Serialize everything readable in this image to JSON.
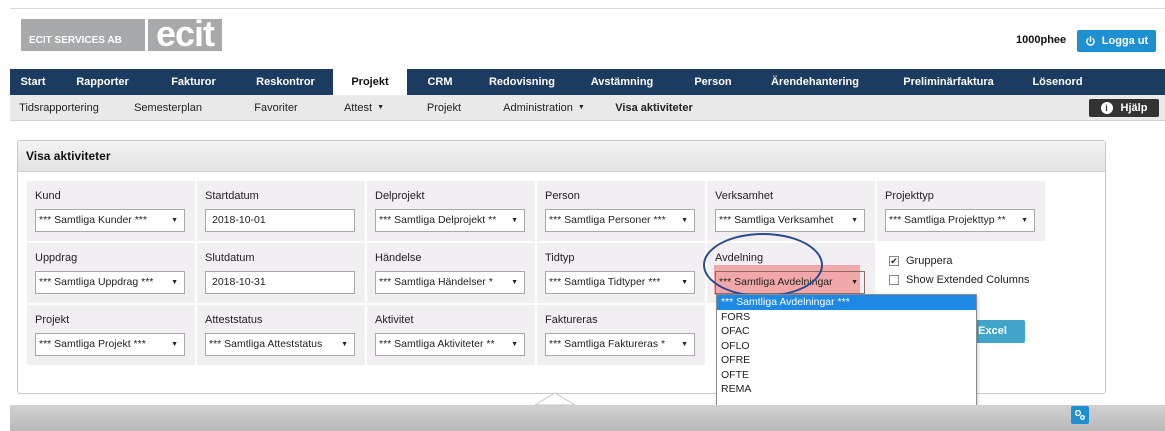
{
  "header": {
    "logo_left": "ECIT SERVICES AB",
    "logo_right": "ecit",
    "username": "1000phee",
    "logout_label": "Logga ut"
  },
  "main_nav": [
    "Start",
    "Rapporter",
    "Fakturor",
    "Reskontror",
    "Projekt",
    "CRM",
    "Redovisning",
    "Avstämning",
    "Person",
    "Ärendehantering",
    "Preliminärfaktura",
    "Lösenord"
  ],
  "main_nav_active": "Projekt",
  "sub_nav": [
    "Tidsrapportering",
    "Semesterplan",
    "Favoriter",
    "Attest",
    "Projekt",
    "Administration",
    "Visa aktiviteter"
  ],
  "help_label": "Hjälp",
  "panel": {
    "title": "Visa aktiviteter",
    "fields": {
      "kund": {
        "label": "Kund",
        "value": "*** Samtliga Kunder ***"
      },
      "startdatum": {
        "label": "Startdatum",
        "value": "2018-10-01"
      },
      "delprojekt": {
        "label": "Delprojekt",
        "value": "*** Samtliga Delprojekt **"
      },
      "person": {
        "label": "Person",
        "value": "*** Samtliga Personer ***"
      },
      "verksamhet": {
        "label": "Verksamhet",
        "value": "*** Samtliga Verksamhet"
      },
      "projekttyp": {
        "label": "Projekttyp",
        "value": "*** Samtliga Projekttyp **"
      },
      "uppdrag": {
        "label": "Uppdrag",
        "value": "*** Samtliga Uppdrag ***"
      },
      "slutdatum": {
        "label": "Slutdatum",
        "value": "2018-10-31"
      },
      "handelse": {
        "label": "Händelse",
        "value": "*** Samtliga Händelser *"
      },
      "tidtyp": {
        "label": "Tidtyp",
        "value": "*** Samtliga Tidtyper ***"
      },
      "avdelning": {
        "label": "Avdelning",
        "value": "*** Samtliga Avdelningar"
      },
      "projekt": {
        "label": "Projekt",
        "value": "*** Samtliga Projekt ***"
      },
      "atteststatus": {
        "label": "Atteststatus",
        "value": "*** Samtliga Atteststatus"
      },
      "aktivitet": {
        "label": "Aktivitet",
        "value": "*** Samtliga Aktiviteter **"
      },
      "faktureras": {
        "label": "Faktureras",
        "value": "*** Samtliga Faktureras *"
      }
    },
    "gruppera_label": "Gruppera",
    "gruppera_checked": true,
    "extended_label": "Show Extended Columns",
    "extended_checked": false,
    "excel_label": "Excel",
    "dropdown_options": [
      "*** Samtliga Avdelningar ***",
      "FORS",
      "OFAC",
      "OFLO",
      "OFRE",
      "OFTE",
      "REMA"
    ],
    "dropdown_selected": "*** Samtliga Avdelningar ***"
  },
  "colors": {
    "nav_bg": "#1b3b61",
    "accent_blue": "#1e8fd0",
    "excel_button": "#40a5c8",
    "highlight": "#f2a8a8",
    "selected_option": "#1e88e5"
  }
}
